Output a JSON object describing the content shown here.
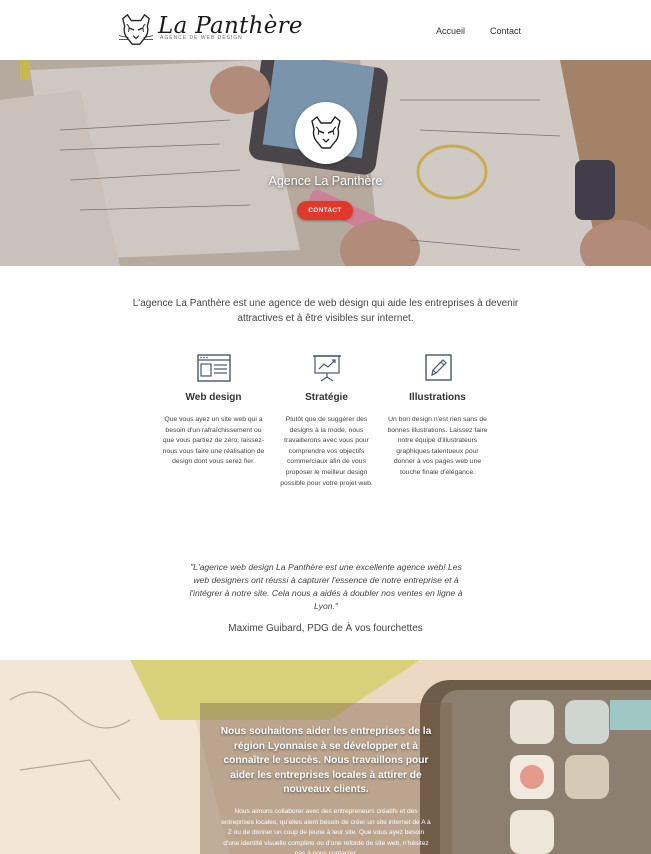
{
  "navbar": {
    "brand_name": "La Panthère",
    "brand_tagline": "agence de web design",
    "links": [
      {
        "label": "Accueil"
      },
      {
        "label": "Contact"
      }
    ]
  },
  "hero": {
    "title": "Agence La Panthère",
    "button_label": "CONTACT",
    "logo_icon": "panther-logo"
  },
  "intro": {
    "text": "L'agence La Panthère est une agence de web design qui aide les entreprises à devenir attractives et à être visibles sur internet."
  },
  "services": [
    {
      "icon": "web-design-icon",
      "title": "Web design",
      "text": "Que vous ayez un site web qui a besoin d'un rafraîchissement ou que vous partiez de zéro, laissez-nous vous faire une réalisation de design dont vous serez fier."
    },
    {
      "icon": "strategy-chart-icon",
      "title": "Stratégie",
      "text": "Plutôt que de suggérer des designs à la mode, nous travaillerons avec vous pour comprendre vos objectifs commerciaux afin de vous proposer le meilleur design possible pour votre projet web."
    },
    {
      "icon": "pencil-edit-icon",
      "title": "Illustrations",
      "text": "Un bon design n'est rien sans de bonnes illustrations. Laissez faire notre équipe d'illustrateurs graphiques talentueux pour donner à vos pages web une touche finale d'élégance."
    }
  ],
  "testimonial": {
    "quote": "\"L'agence web design La Panthère est une excellente agence web! Les web designers ont réussi à capturer l'essence de notre entreprise et à l'intégrer à notre site. Cela nous a aidés à doubler nos ventes en ligne à Lyon.\"",
    "author": "Maxime Guibard, PDG de À vos fourchettes"
  },
  "bottom": {
    "headline": "Nous souhaitons aider les entreprises de la région Lyonnaise à se développer et à connaître le succès. Nous travaillons pour aider les entreprises locales à attirer de nouveaux clients.",
    "text": "Nous aimons collaborer avec des entrepreneurs créatifs et des entreprises locales, qu'elles aient besoin de créer un site internet de A à Z ou de donner un coup de jeune à leur site. Que vous ayez besoin d'une identité visuelle complète ou d'une refonte de site web, n'hésitez pas à nous contacter."
  },
  "colors": {
    "accent": "#e0392b",
    "icon_stroke": "#4a5670",
    "text": "#444444"
  }
}
